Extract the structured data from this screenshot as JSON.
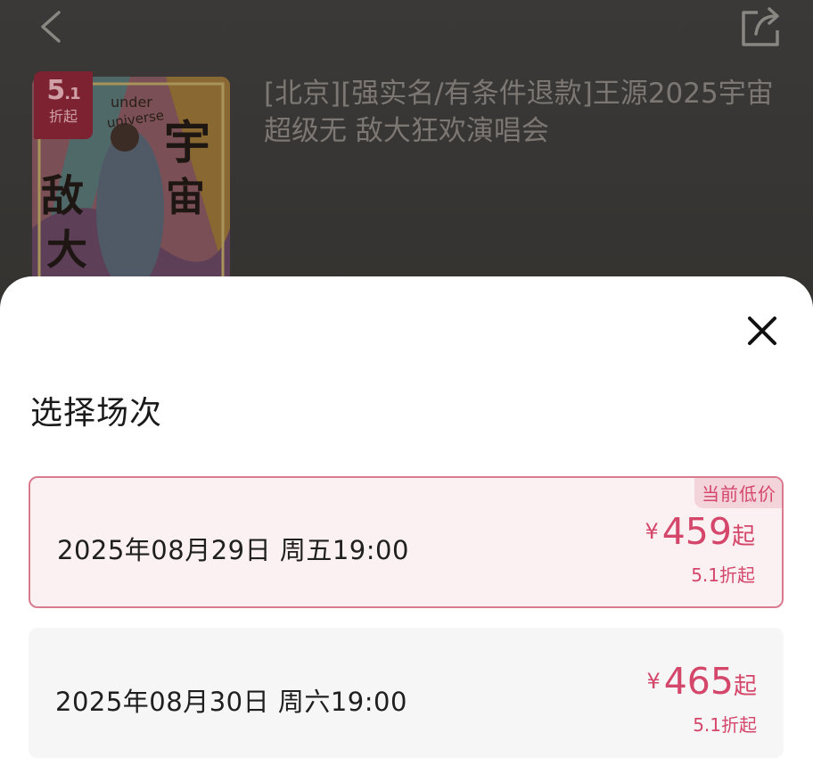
{
  "header": {
    "back_icon": "chevron-left-icon",
    "share_icon": "share-icon"
  },
  "event": {
    "badge_number": "5.1",
    "badge_main": "5",
    "badge_decimal": ".1",
    "badge_suffix": "折起",
    "title": "[北京][强实名/有条件退款]王源2025宇宙超级无 敌大狂欢演唱会",
    "poster_text": [
      "under",
      "universe",
      "宇",
      "宙",
      "敌",
      "大"
    ]
  },
  "sheet": {
    "title": "选择场次",
    "close_icon": "close-icon",
    "sessions": [
      {
        "date": "2025年08月29日  周五19:00",
        "currency": "¥",
        "price": "459",
        "price_suffix": "起",
        "discount": "5.1折起",
        "tag": "当前低价",
        "selected": true
      },
      {
        "date": "2025年08月30日  周六19:00",
        "currency": "¥",
        "price": "465",
        "price_suffix": "起",
        "discount": "5.1折起",
        "selected": false
      }
    ]
  },
  "colors": {
    "accent": "#d4466a",
    "selected_border": "#d97a8e",
    "selected_bg": "#fbf1f2",
    "tag_bg": "#f2d4da",
    "overlay_bg": "#34322f"
  }
}
